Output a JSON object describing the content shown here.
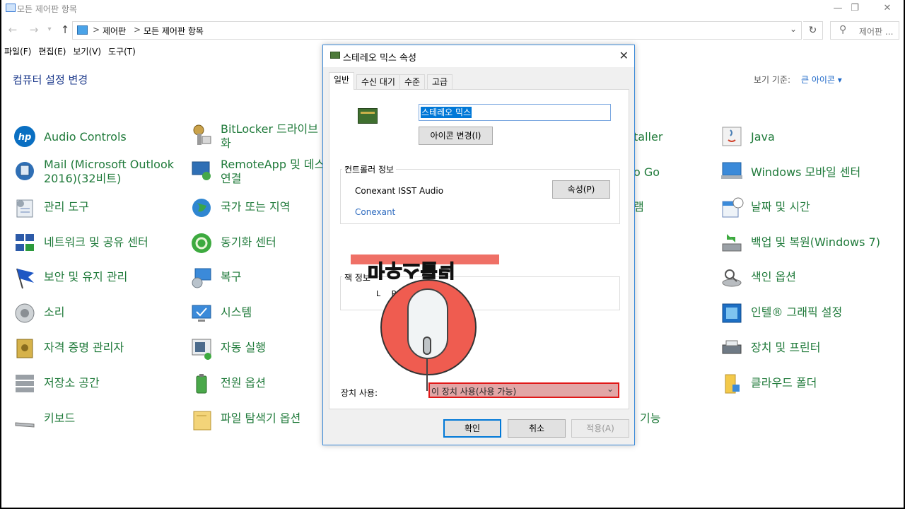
{
  "window": {
    "title": "모든 제어판 항목",
    "caption": {
      "minimize": "—",
      "restore": "❐",
      "close": "✕"
    }
  },
  "address": {
    "crumb1": "제어판",
    "crumb2": "모든 제어판 항목",
    "separator": ">",
    "search_placeholder": "제어판 ..."
  },
  "menu": [
    "파일(F)",
    "편집(E)",
    "보기(V)",
    "도구(T)"
  ],
  "header": {
    "title": "컴퓨터 설정 변경",
    "view_by_label": "보기 기준:",
    "view_by_value": "큰 아이콘 ▾"
  },
  "items": [
    {
      "label": "Audio Controls",
      "icon": "hp-icon"
    },
    {
      "label": "Mail (Microsoft Outlook\n2016)(32비트)",
      "icon": "mail-icon"
    },
    {
      "label": "관리 도구",
      "icon": "admin-tools-icon"
    },
    {
      "label": "네트워크 및 공유 센터",
      "icon": "network-icon"
    },
    {
      "label": "보안 및 유지 관리",
      "icon": "flag-icon"
    },
    {
      "label": "소리",
      "icon": "speaker-icon"
    },
    {
      "label": "자격 증명 관리자",
      "icon": "credential-icon"
    },
    {
      "label": "저장소 공간",
      "icon": "storage-icon"
    },
    {
      "label": "키보드",
      "icon": "keyboard-icon"
    },
    {
      "label": "BitLocker 드라이브 ｜\n화",
      "icon": "bitlocker-icon"
    },
    {
      "label": "RemoteApp 및 데스\n연결",
      "icon": "remoteapp-icon"
    },
    {
      "label": "국가 또는 지역",
      "icon": "globe-icon"
    },
    {
      "label": "동기화 센터",
      "icon": "sync-icon"
    },
    {
      "label": "복구",
      "icon": "recovery-icon"
    },
    {
      "label": "시스템",
      "icon": "system-icon"
    },
    {
      "label": "자동 실행",
      "icon": "autoplay-icon"
    },
    {
      "label": "전원 옵션",
      "icon": "power-icon"
    },
    {
      "label": "파일 탐색기 옵션",
      "icon": "folder-options-icon"
    },
    {
      "label": "taller",
      "icon": ""
    },
    {
      "label": "o Go",
      "icon": ""
    },
    {
      "label": "램",
      "icon": ""
    },
    {
      "label": "기능",
      "icon": ""
    },
    {
      "label": "Java",
      "icon": "java-icon"
    },
    {
      "label": "Windows 모바일 센터",
      "icon": "mobility-icon"
    },
    {
      "label": "날짜 및 시간",
      "icon": "calendar-icon"
    },
    {
      "label": "백업 및 복원(Windows 7)",
      "icon": "backup-icon"
    },
    {
      "label": "색인 옵션",
      "icon": "indexing-icon"
    },
    {
      "label": "인텔® 그래픽 설정",
      "icon": "intel-icon"
    },
    {
      "label": "장치 및 프린터",
      "icon": "printer-icon"
    },
    {
      "label": "클라우드 폴더",
      "icon": "cloud-folder-icon"
    }
  ],
  "dialog": {
    "title": "스테레오 믹스 속성",
    "close": "✕",
    "tabs": [
      "일반",
      "수신 대기",
      "수준",
      "고급"
    ],
    "device_name": "스테레오 믹스",
    "change_icon_button": "아이콘 변경(I)",
    "controller_group": "컨트롤러 정보",
    "controller_name": "Conexant ISST Audio",
    "controller_vendor": "Conexant",
    "properties_button": "속성(P)",
    "jack_group": "잭 정보",
    "jack_channels": "L R",
    "device_usage_label": "장치 사용:",
    "device_usage_value": "이 장치 사용(사용 가능)",
    "ok_button": "확인",
    "cancel_button": "취소",
    "apply_button": "적용(A)"
  },
  "overlay": {
    "text": "마우스클릭",
    "accent": "#ef5c50"
  }
}
